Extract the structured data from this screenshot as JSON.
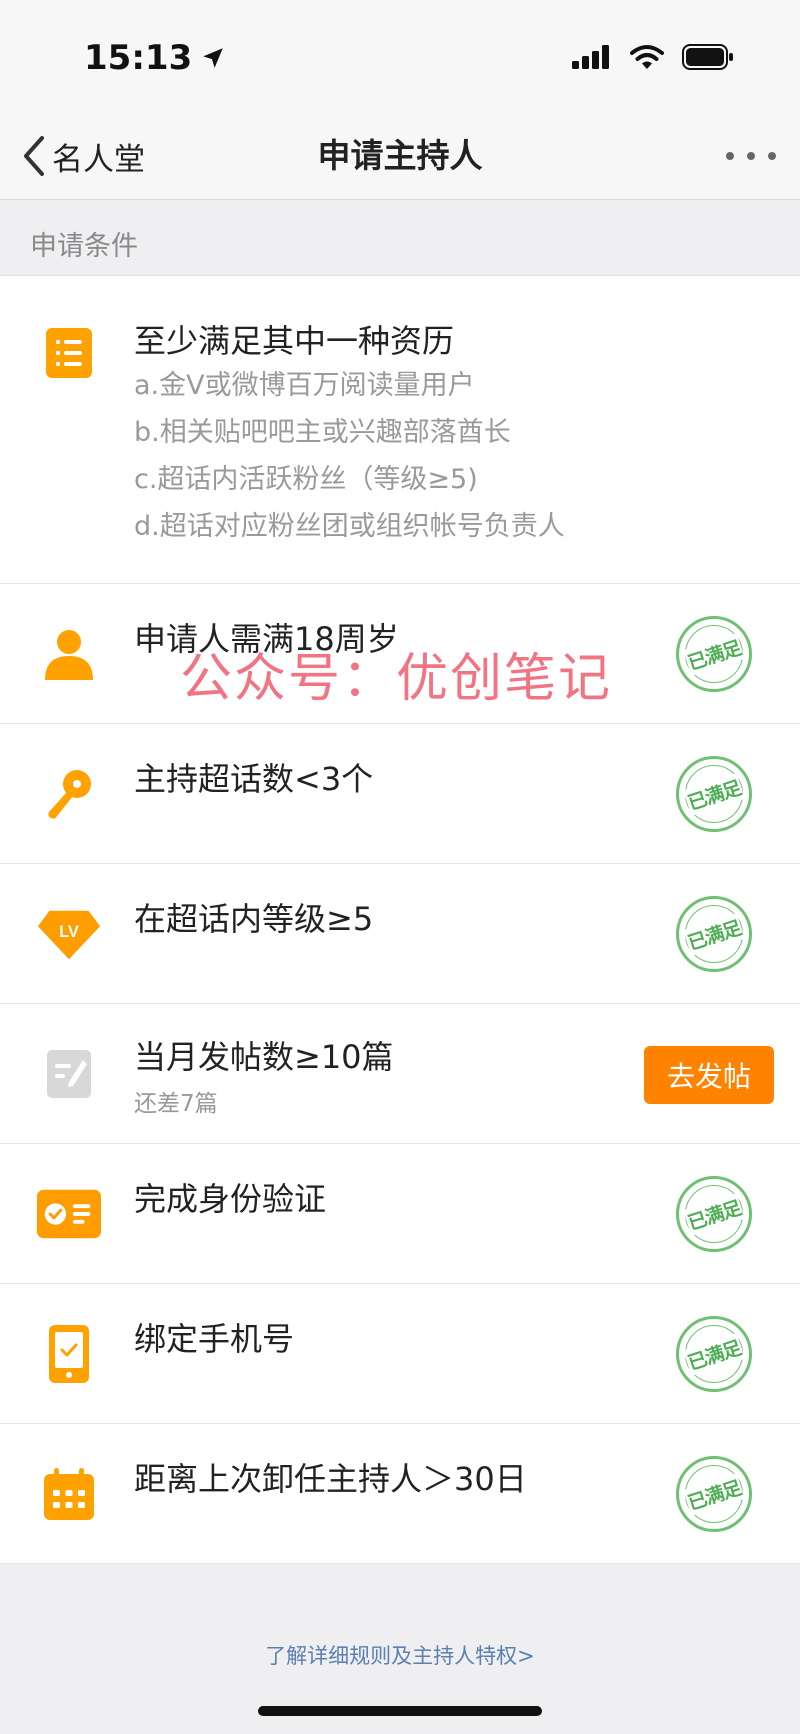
{
  "status_bar": {
    "time": "15:13"
  },
  "nav": {
    "back_label": "名人堂",
    "title": "申请主持人"
  },
  "section": {
    "label": "申请条件"
  },
  "requirements": {
    "title": "至少满足其中一种资历",
    "items": [
      "a.金V或微博百万阅读量用户",
      "b.相关贴吧吧主或兴趣部落酋长",
      "c.超话内活跃粉丝（等级≥5)",
      "d.超话对应粉丝团或组织帐号负责人"
    ]
  },
  "conditions": [
    {
      "title": "申请人需满18周岁",
      "status": "已满足",
      "icon": "person-icon"
    },
    {
      "title": "主持超话数<3个",
      "status": "已满足",
      "icon": "microphone-icon"
    },
    {
      "title": "在超话内等级≥5",
      "status": "已满足",
      "icon": "level-badge-icon",
      "icon_text": "LV"
    },
    {
      "title": "当月发帖数≥10篇",
      "subtitle": "还差7篇",
      "action": "去发帖",
      "icon": "edit-post-icon"
    },
    {
      "title": "完成身份验证",
      "status": "已满足",
      "icon": "id-card-icon"
    },
    {
      "title": "绑定手机号",
      "status": "已满足",
      "icon": "phone-icon"
    },
    {
      "title": "距离上次卸任主持人＞30日",
      "status": "已满足",
      "icon": "calendar-icon"
    }
  ],
  "watermark": "公众号：优创笔记",
  "footer": {
    "link": "了解详细规则及主持人特权>"
  },
  "colors": {
    "accent": "#ff8200",
    "icon_orange": "#ffa200",
    "stamp_green": "#4fae55",
    "link": "#5b7fb0"
  }
}
